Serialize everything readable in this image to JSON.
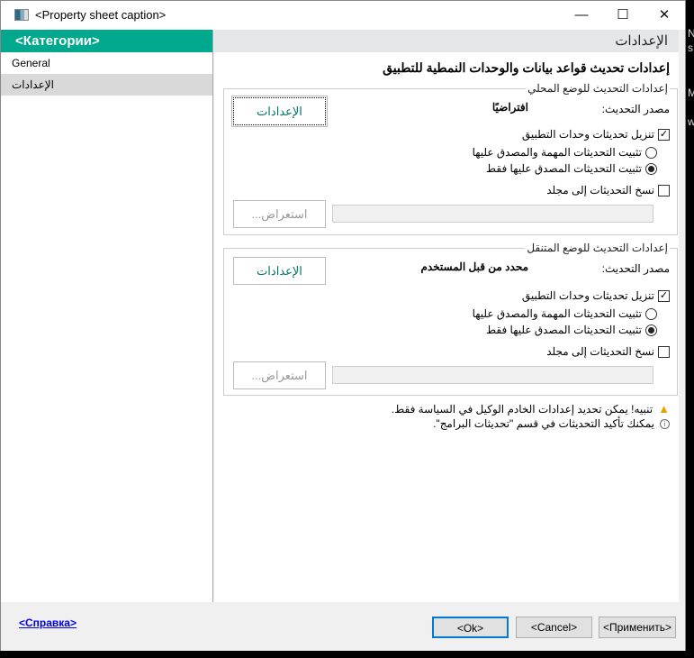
{
  "window": {
    "title": "<Property sheet caption>",
    "minimize": "—",
    "maximize": "☐",
    "close": "✕"
  },
  "sidebar": {
    "header": "<Категории>",
    "items": [
      {
        "label": "General"
      },
      {
        "label": "الإعدادات"
      }
    ]
  },
  "main": {
    "header": "الإعدادات",
    "title": "إعدادات تحديث قواعد بيانات والوحدات النمطية للتطبيق",
    "local": {
      "group_label": "إعدادات التحديث للوضع المحلي",
      "source_label": "مصدر التحديث:",
      "source_value": "افتراضيًا",
      "settings_button": "الإعدادات",
      "download_label": "تنزيل تحديثات وحدات التطبيق",
      "download_checked": true,
      "radio1": "تثبيت التحديثات المهمة والمصدق عليها",
      "radio2": "تثبيت التحديثات المصدق عليها فقط",
      "radio_selected": 2,
      "copy_label": "نسخ التحديثات إلى مجلد",
      "copy_checked": false,
      "folder_value": "",
      "browse_button": "استعراض..."
    },
    "mobile": {
      "group_label": "إعدادات التحديث للوضع المتنقل",
      "source_label": "مصدر التحديث:",
      "source_value": "محدد من قبل المستخدم",
      "settings_button": "الإعدادات",
      "download_label": "تنزيل تحديثات وحدات التطبيق",
      "download_checked": true,
      "radio1": "تثبيت التحديثات المهمة والمصدق عليها",
      "radio2": "تثبيت التحديثات المصدق عليها فقط",
      "radio_selected": 2,
      "copy_label": "نسخ التحديثات إلى مجلد",
      "copy_checked": false,
      "folder_value": "",
      "browse_button": "استعراض..."
    },
    "warning": "تنبيه! يمكن تحديد إعدادات الخادم الوكيل في السياسة فقط.",
    "info": "يمكنك تأكيد التحديثات في قسم \"تحديثات البرامج\"."
  },
  "footer": {
    "help": "<Справка>",
    "ok": "<Ok>",
    "cancel": "<Cancel>",
    "apply": "<Применить>"
  },
  "background": {
    "fragments": [
      "N",
      "s",
      "Ma",
      "wi"
    ]
  },
  "colors": {
    "accent": "#00a88e",
    "link": "#0000ee",
    "focus": "#0078d7"
  }
}
